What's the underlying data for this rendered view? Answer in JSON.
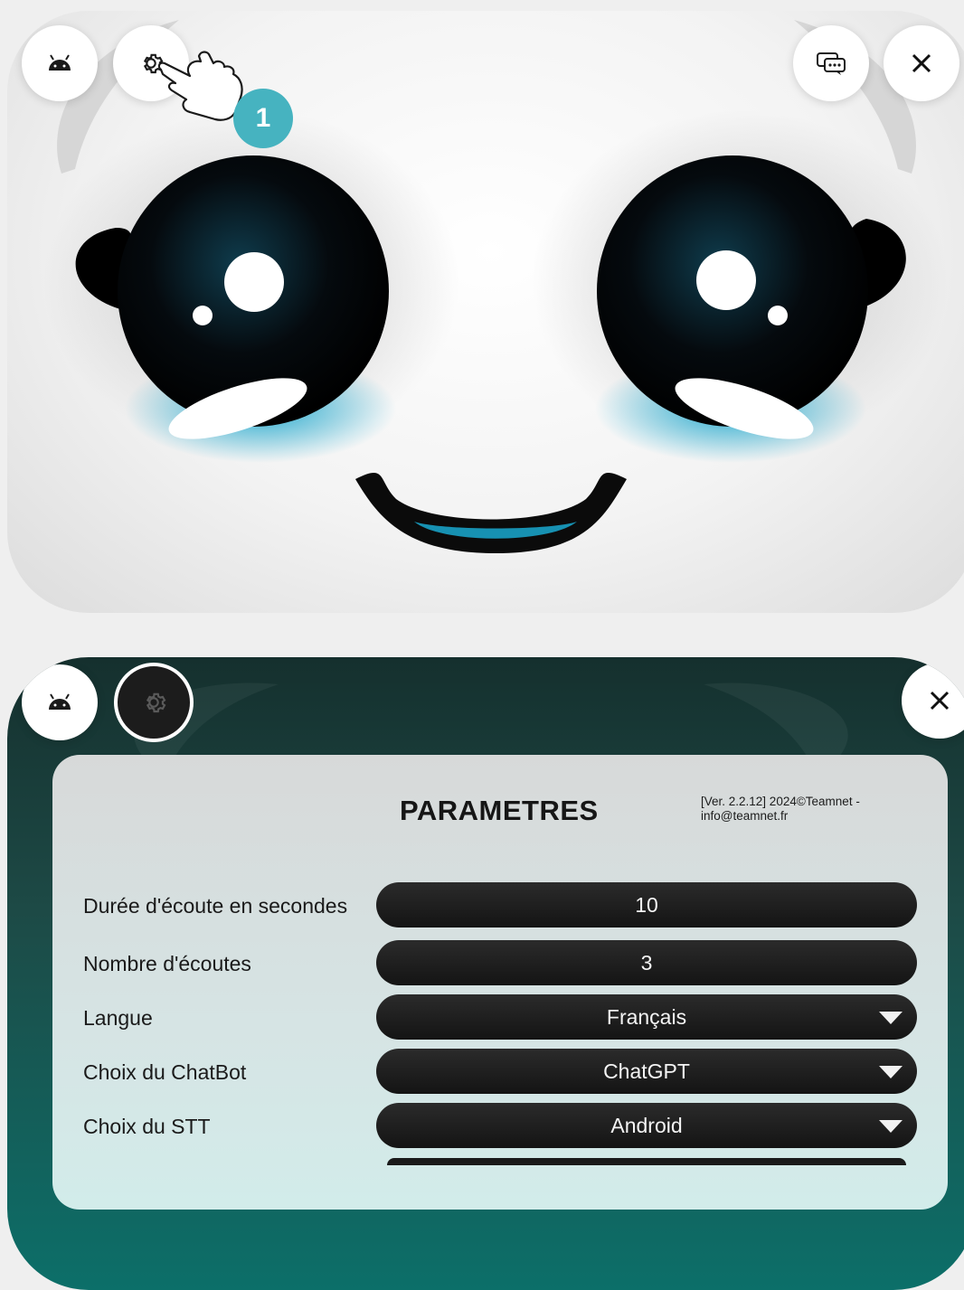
{
  "top_screen": {
    "buttons": {
      "android": "android-icon",
      "settings": "gear-icon",
      "chat": "chat-bubbles-icon",
      "close": "close-icon"
    },
    "step_badge": "1",
    "hand_hint": "pointing-hand-icon"
  },
  "bottom_screen": {
    "settings_panel": {
      "title": "PARAMETRES",
      "version": "[Ver. 2.2.12] 2024©Teamnet - info@teamnet.fr",
      "rows": [
        {
          "label": "Durée d'écoute en secondes",
          "value": "10",
          "kind": "input"
        },
        {
          "label": "Nombre d'écoutes",
          "value": "3",
          "kind": "input"
        },
        {
          "label": "Langue",
          "value": "Français",
          "kind": "select"
        },
        {
          "label": "Choix du ChatBot",
          "value": "ChatGPT",
          "kind": "select"
        },
        {
          "label": "Choix du STT",
          "value": "Android",
          "kind": "select"
        }
      ]
    }
  },
  "colors": {
    "accent_teal": "#46b3c0",
    "eye_glow": "#1aa9d0",
    "field_bg": "#1a1a1a",
    "bottom_bg_dark": "#15302e",
    "bottom_bg_teal": "#0c6f69"
  }
}
